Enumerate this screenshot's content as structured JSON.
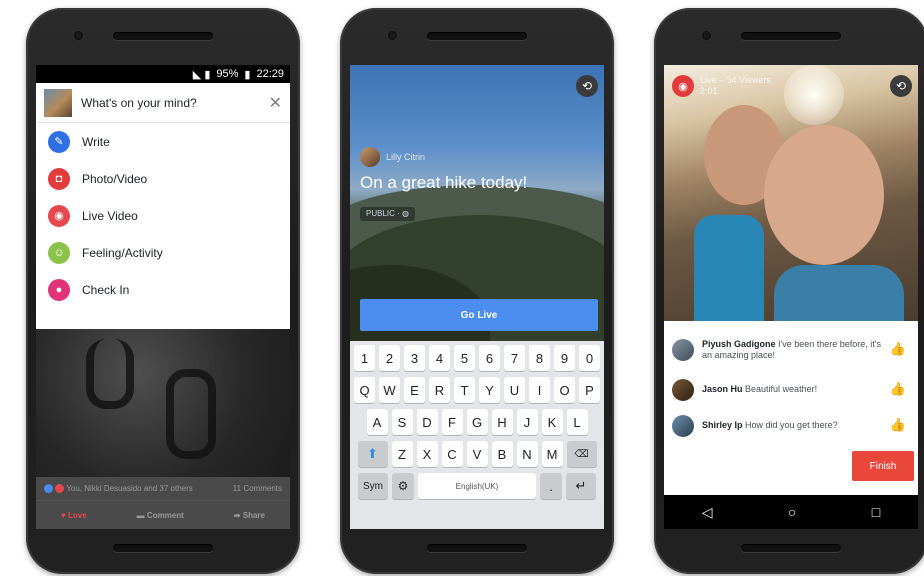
{
  "phone1": {
    "status": {
      "signal_text": "95%",
      "time": "22:29"
    },
    "composer": {
      "prompt": "What's on your mind?",
      "close_glyph": "✕"
    },
    "menu": [
      {
        "label": "Write",
        "icon": "pencil-icon",
        "color": "#2f6fe4",
        "glyph": "✎"
      },
      {
        "label": "Photo/Video",
        "icon": "camera-icon",
        "color": "#e23b3b",
        "glyph": "◘"
      },
      {
        "label": "Live Video",
        "icon": "live-video-icon",
        "color": "#e5474c",
        "glyph": "◉"
      },
      {
        "label": "Feeling/Activity",
        "icon": "smiley-icon",
        "color": "#8bc34a",
        "glyph": "☺"
      },
      {
        "label": "Check In",
        "icon": "location-pin-icon",
        "color": "#e2327a",
        "glyph": "●"
      }
    ],
    "feed": {
      "reactions_text": "You, Nikki Desuasido and 37 others",
      "comments_count": "11 Comments",
      "actions": [
        "Love",
        "Comment",
        "Share"
      ]
    }
  },
  "phone2": {
    "author": "Lilly Citrin",
    "post_text": "On a great hike today!",
    "privacy": "PUBLIC",
    "go_live_label": "Go Live",
    "keyboard": {
      "row1": [
        "1",
        "2",
        "3",
        "4",
        "5",
        "6",
        "7",
        "8",
        "9",
        "0"
      ],
      "row2": [
        "Q",
        "W",
        "E",
        "R",
        "T",
        "Y",
        "U",
        "I",
        "O",
        "P"
      ],
      "row3": [
        "A",
        "S",
        "D",
        "F",
        "G",
        "H",
        "J",
        "K",
        "L"
      ],
      "row4": [
        "Z",
        "X",
        "C",
        "V",
        "B",
        "N",
        "M"
      ],
      "sym_label": "Sym",
      "space_label": "English(UK)",
      "period": "."
    }
  },
  "phone3": {
    "live_label": "Live",
    "viewers": "34 Viewers",
    "time": "2:01",
    "comments": [
      {
        "name": "Piyush Gadigone",
        "text": "I've been there before, it's an amazing place!",
        "liked": true
      },
      {
        "name": "Jason Hu",
        "text": "Beautiful weather!",
        "liked": false
      },
      {
        "name": "Shirley Ip",
        "text": "How did you get there?",
        "liked": false
      }
    ],
    "finish_label": "Finish"
  }
}
